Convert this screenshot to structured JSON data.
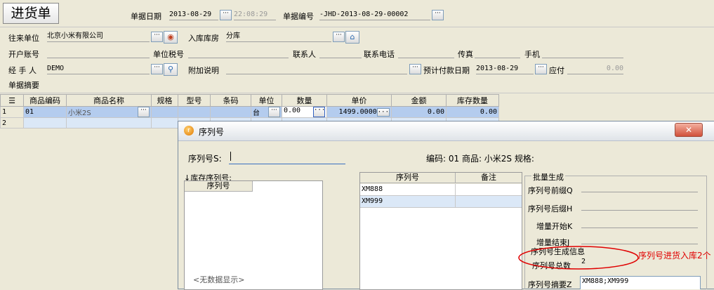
{
  "window": {
    "title": "进货单"
  },
  "header": {
    "date_label": "单据日期",
    "date": "2013-08-29",
    "time": "22:08:29",
    "number_label": "单据编号",
    "number": "-JHD-2013-08-29-00002"
  },
  "form": {
    "partner_label": "往来单位",
    "partner": "北京小米有限公司",
    "warehouse_label": "入库库房",
    "warehouse": "分库",
    "bank_label": "开户账号",
    "tax_label": "单位税号",
    "contact_label": "联系人",
    "phone_label": "联系电话",
    "fax_label": "传真",
    "mobile_label": "手机",
    "handler_label": "经 手 人",
    "handler": "DEMO",
    "note_label": "附加说明",
    "paydate_label": "预计付款日期",
    "paydate": "2013-08-29",
    "payable_label": "应付",
    "payable": "0.00",
    "summary_label": "单据摘要"
  },
  "grid": {
    "columns": [
      "商品编码",
      "商品名称",
      "规格",
      "型号",
      "条码",
      "单位",
      "数量",
      "单价",
      "金额",
      "库存数量"
    ],
    "rows": [
      {
        "no": "1",
        "code": "01",
        "name": "小米2S",
        "unit": "台",
        "qty": "0.00",
        "price": "1499.0000",
        "amount": "0.00",
        "stock": "0.00"
      },
      {
        "no": "2",
        "code": "",
        "name": "",
        "unit": "",
        "qty": "",
        "price": "",
        "amount": "",
        "stock": ""
      }
    ]
  },
  "dialog": {
    "title": "序列号",
    "serial_label": "序列号S:",
    "serial_value": "",
    "info": "编码: 01 商品: 小米2S 规格:",
    "stock_serial_label": "↓库存序列号:",
    "stock_col": "序列号",
    "no_data": "<无数据显示>",
    "list_cols": [
      "序列号",
      "备注"
    ],
    "list_rows": [
      {
        "serial": "XM888",
        "note": ""
      },
      {
        "serial": "XM999",
        "note": ""
      }
    ],
    "batch_title": "批量生成",
    "prefix_label": "序列号前缀Q",
    "suffix_label": "序列号后缀H",
    "inc_start_label": "增量开始K",
    "inc_end_label": "增量结束J",
    "gen_info_label": "序列号生成信息",
    "total_label": "序列号总数",
    "total_value": "2",
    "summary_label": "序列号摘要Z",
    "summary_value": "XM888;XM999"
  },
  "annotation": {
    "text": "序列号进货入库2个",
    "color": "#e00000"
  },
  "colors": {
    "selected_row": "#b4ccee",
    "row2": "#dbe8f7"
  }
}
